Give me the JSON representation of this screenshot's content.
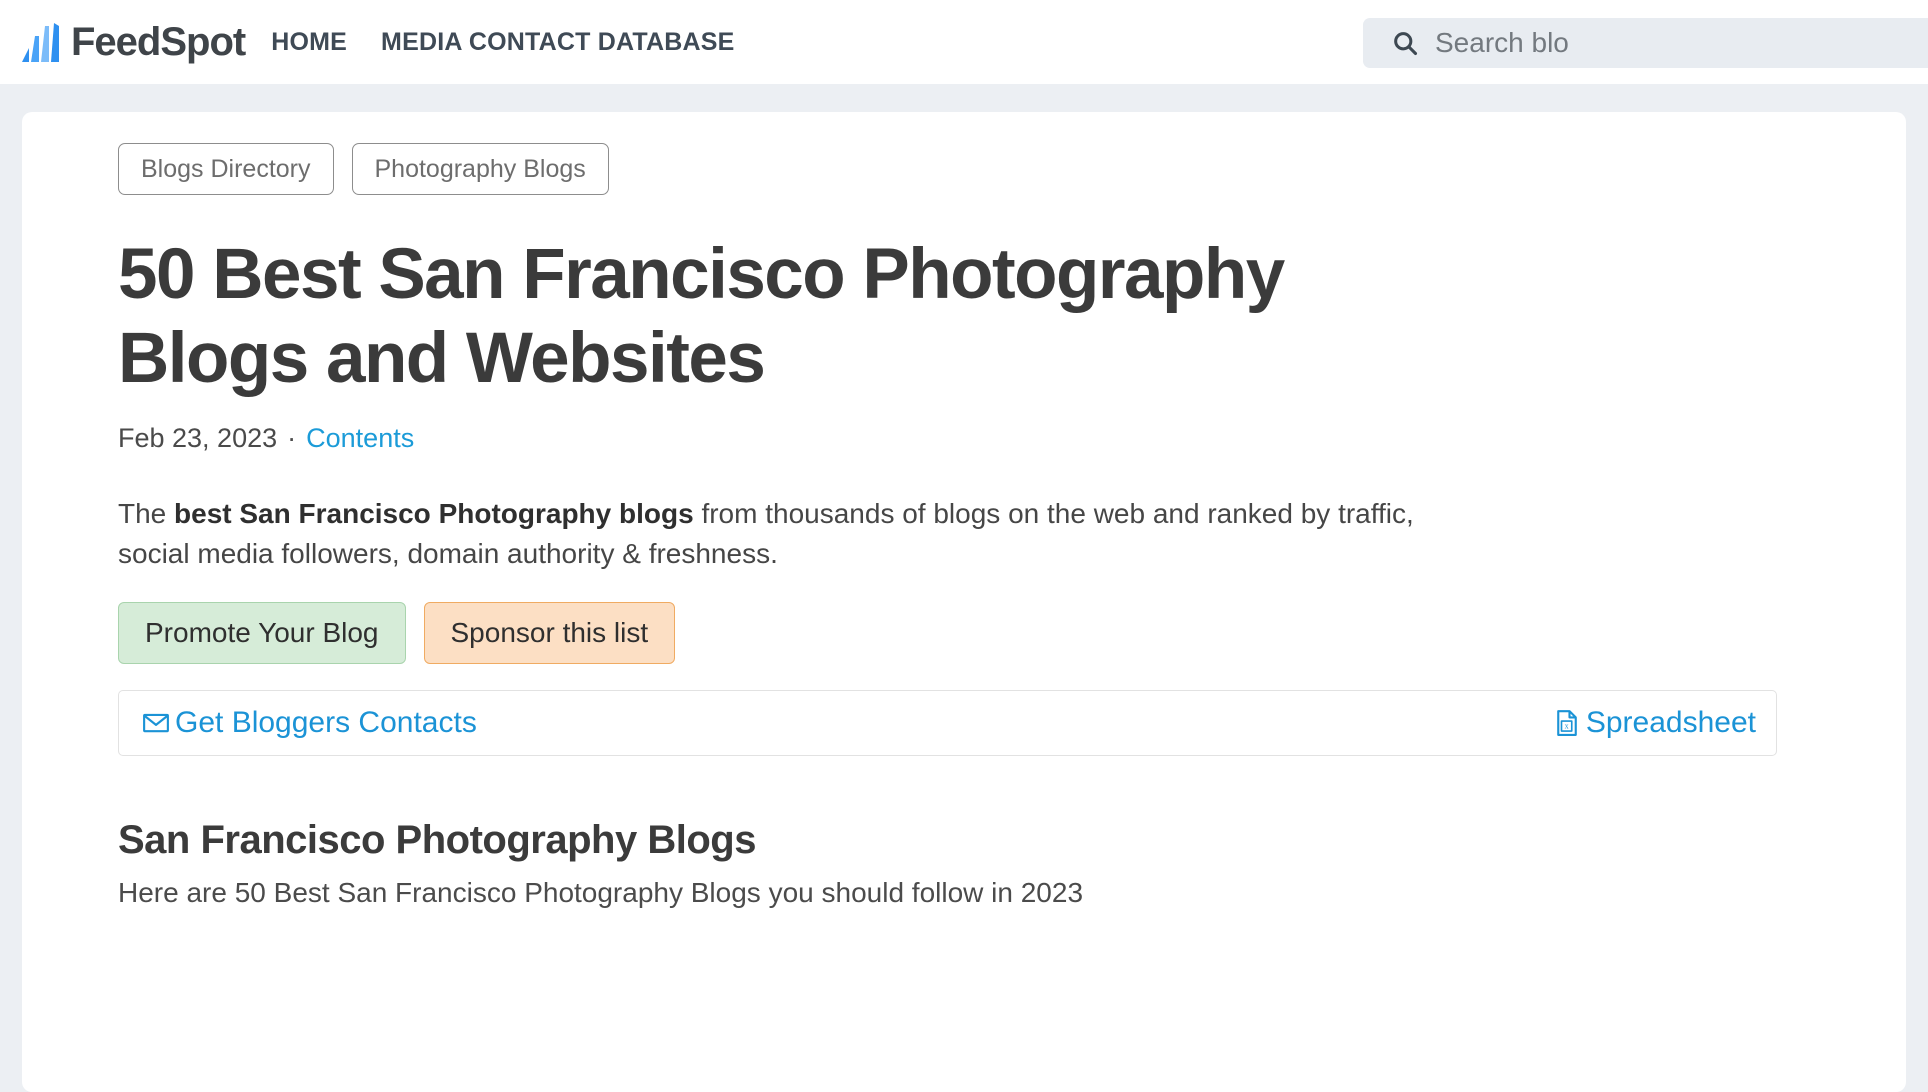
{
  "header": {
    "brand_name": "FeedSpot",
    "logo_icon": "feedspot-logo-icon",
    "nav": [
      {
        "label": "HOME",
        "name": "nav-home"
      },
      {
        "label": "MEDIA CONTACT DATABASE",
        "name": "nav-media-contact-database"
      }
    ],
    "search": {
      "icon": "search-icon",
      "placeholder": "Search blo",
      "value": ""
    }
  },
  "breadcrumbs": [
    {
      "label": "Blogs Directory"
    },
    {
      "label": "Photography Blogs"
    }
  ],
  "article": {
    "title": "50 Best San Francisco Photography Blogs and Websites",
    "date": "Feb 23, 2023",
    "separator": "·",
    "contents_link": "Contents",
    "description_prefix": "The ",
    "description_bold": "best San Francisco Photography blogs",
    "description_suffix": " from thousands of blogs on the web and ranked by traffic, social media followers, domain authority & freshness."
  },
  "actions": {
    "promote_label": "Promote Your Blog",
    "sponsor_label": "Sponsor this list"
  },
  "contact_bar": {
    "contacts_icon": "envelope-icon",
    "contacts_label": "Get Bloggers Contacts",
    "spreadsheet_icon": "spreadsheet-file-icon",
    "spreadsheet_label": "Spreadsheet"
  },
  "section": {
    "title": "San Francisco Photography Blogs",
    "subtitle": "Here are 50 Best San Francisco Photography Blogs you should follow in 2023"
  },
  "colors": {
    "page_background": "#eceff3",
    "card_background": "#ffffff",
    "brand_blue": "#3399ff",
    "link_blue": "#1b93d6",
    "promote_background": "#d6ecd8",
    "promote_border": "#a9d4ad",
    "sponsor_background": "#fcdfc4",
    "sponsor_border": "#f0ab62",
    "search_background": "#e8ecf1",
    "heading_text": "#3b3b3b"
  }
}
